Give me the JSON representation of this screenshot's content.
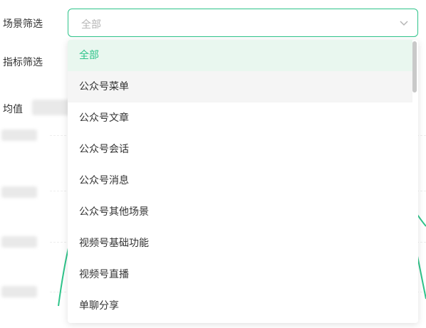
{
  "filters": {
    "scene_label": "场景筛选",
    "metric_label": "指标筛选",
    "scene_select_value": "全部"
  },
  "summary": {
    "avg_label": "均值"
  },
  "dropdown": {
    "options": [
      {
        "label": "全部",
        "state": "selected"
      },
      {
        "label": "公众号菜单",
        "state": "hover"
      },
      {
        "label": "公众号文章",
        "state": "normal"
      },
      {
        "label": "公众号会话",
        "state": "normal"
      },
      {
        "label": "公众号消息",
        "state": "normal"
      },
      {
        "label": "公众号其他场景",
        "state": "normal"
      },
      {
        "label": "视频号基础功能",
        "state": "normal"
      },
      {
        "label": "视频号直播",
        "state": "normal"
      },
      {
        "label": "单聊分享",
        "state": "normal"
      }
    ]
  },
  "colors": {
    "accent": "#2ec48a",
    "selected_bg": "#e9f7ef",
    "hover_bg": "#f5f5f5"
  },
  "icons": {
    "select_arrow": "chevron-down-icon"
  }
}
